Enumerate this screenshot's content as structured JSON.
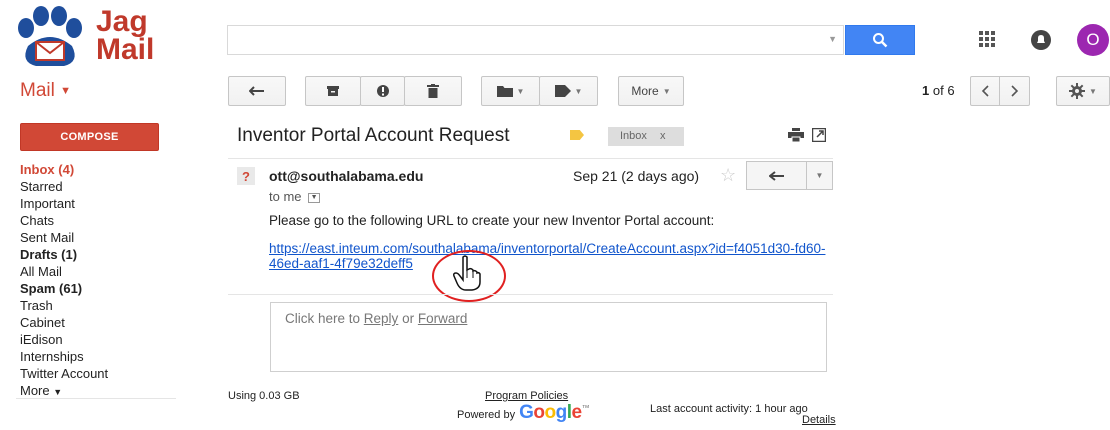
{
  "logo": {
    "line1": "Jag",
    "line2": "Mail"
  },
  "search": {
    "value": "",
    "placeholder": ""
  },
  "user": {
    "initial": "O"
  },
  "toolbar": {
    "mail_label": "Mail",
    "more_label": "More",
    "page_count_range": "1",
    "page_count_of": "of 6"
  },
  "sidebar": {
    "compose_label": "COMPOSE",
    "items": [
      {
        "label": "Inbox (4)"
      },
      {
        "label": "Starred"
      },
      {
        "label": "Important"
      },
      {
        "label": "Chats"
      },
      {
        "label": "Sent Mail"
      },
      {
        "label": "Drafts (1)"
      },
      {
        "label": "All Mail"
      },
      {
        "label": "Spam (61)"
      },
      {
        "label": "Trash"
      },
      {
        "label": "Cabinet"
      },
      {
        "label": "iEdison"
      },
      {
        "label": "Internships"
      },
      {
        "label": "Twitter Account"
      },
      {
        "label": "More"
      }
    ]
  },
  "message": {
    "subject": "Inventor Portal Account Request",
    "label_chip": "Inbox",
    "label_chip_close": "x",
    "sender_avatar": "?",
    "from": "ott@southalabama.edu",
    "date": "Sep 21 (2 days ago)",
    "to": "to me",
    "body": "Please go to the following URL to create your new Inventor Portal account:",
    "link": "https://east.inteum.com/southalabama/inventorportal/CreateAccount.aspx?id=f4051d30-fd60-46ed-aaf1-4f79e32deff5"
  },
  "reply_box": {
    "prefix": "Click here to",
    "reply": "Reply",
    "or": "or",
    "forward": "Forward"
  },
  "footer": {
    "storage": "Using 0.03 GB",
    "policies": "Program Policies",
    "powered_by": "Powered by",
    "activity": "Last account activity: 1 hour ago",
    "details": "Details"
  },
  "colors": {
    "brand_red": "#d14836",
    "search_blue": "#4285f4",
    "link_blue": "#1155cc",
    "annotation_red": "#e02020",
    "avatar_purple": "#9c27b0"
  },
  "icons": [
    "search-icon",
    "apps-grid-icon",
    "notifications-icon",
    "back-arrow-icon",
    "archive-icon",
    "report-spam-icon",
    "trash-icon",
    "folder-icon",
    "label-icon",
    "chevron-left-icon",
    "chevron-right-icon",
    "gear-icon",
    "print-icon",
    "new-window-icon",
    "star-icon",
    "reply-icon",
    "hand-cursor-icon"
  ]
}
